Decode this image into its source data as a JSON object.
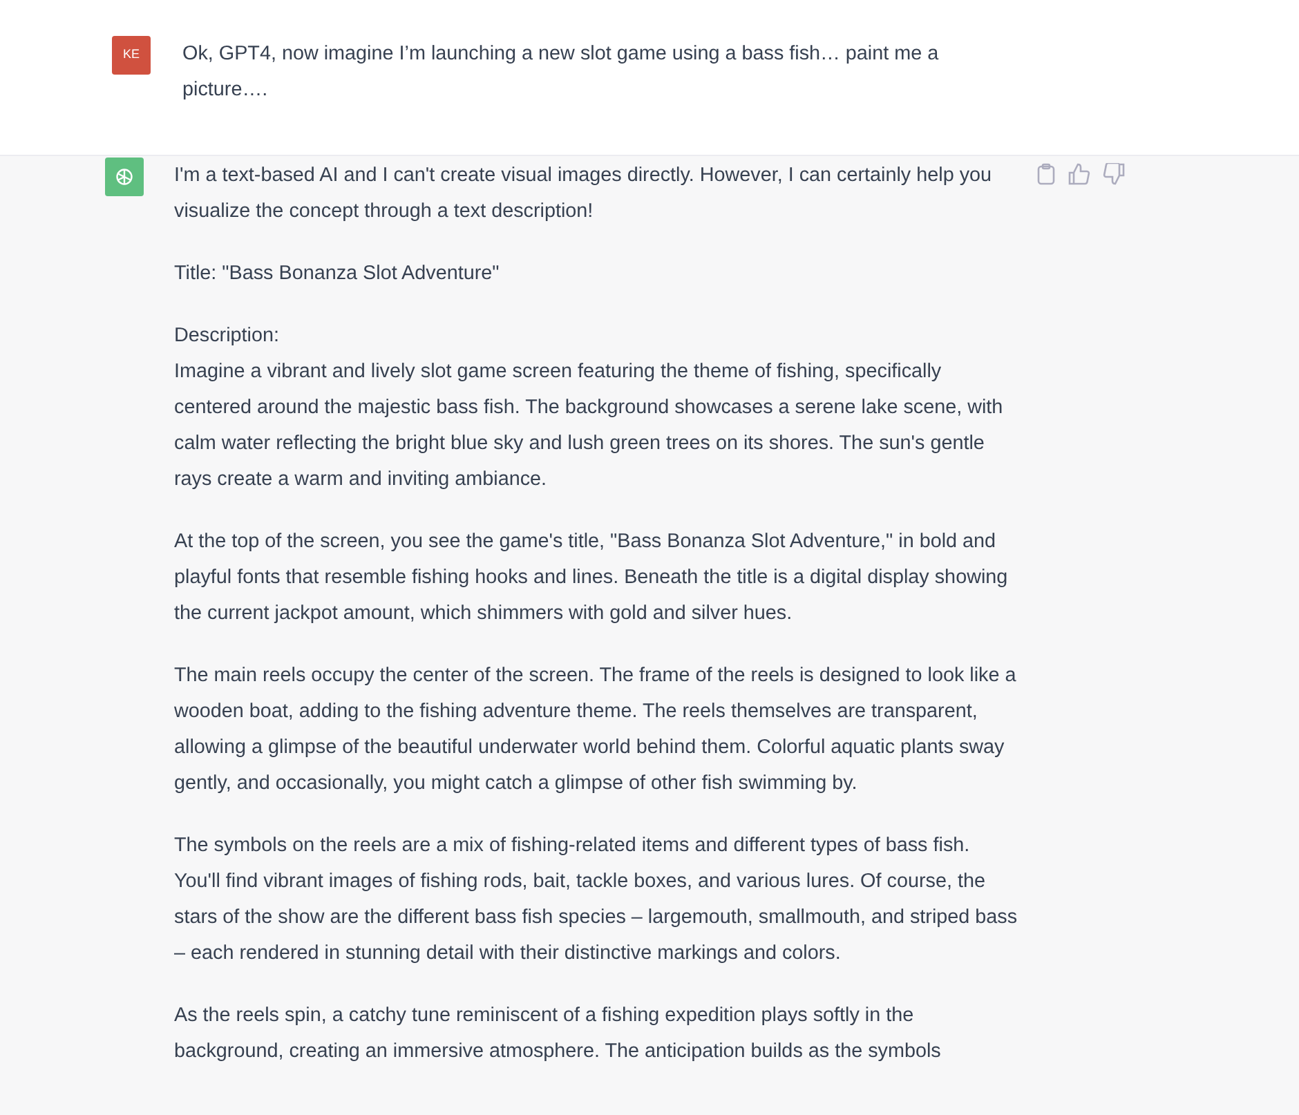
{
  "user_message": {
    "avatar": "KE",
    "text": "Ok, GPT4, now imagine I’m launching a new slot game using a bass fish… paint me a picture…."
  },
  "assistant_message": {
    "paragraphs": [
      "I'm a text-based AI and I can't create visual images directly. However, I can certainly help you visualize the concept through a text description!",
      "Title: \"Bass Bonanza Slot Adventure\"",
      "Description:\nImagine a vibrant and lively slot game screen featuring the theme of fishing, specifically centered around the majestic bass fish. The background showcases a serene lake scene, with calm water reflecting the bright blue sky and lush green trees on its shores. The sun's gentle rays create a warm and inviting ambiance.",
      "At the top of the screen, you see the game's title, \"Bass Bonanza Slot Adventure,\" in bold and playful fonts that resemble fishing hooks and lines. Beneath the title is a digital display showing the current jackpot amount, which shimmers with gold and silver hues.",
      "The main reels occupy the center of the screen. The frame of the reels is designed to look like a wooden boat, adding to the fishing adventure theme. The reels themselves are transparent, allowing a glimpse of the beautiful underwater world behind them. Colorful aquatic plants sway gently, and occasionally, you might catch a glimpse of other fish swimming by.",
      "The symbols on the reels are a mix of fishing-related items and different types of bass fish. You'll find vibrant images of fishing rods, bait, tackle boxes, and various lures. Of course, the stars of the show are the different bass fish species – largemouth, smallmouth, and striped bass – each rendered in stunning detail with their distinctive markings and colors.",
      "As the reels spin, a catchy tune reminiscent of a fishing expedition plays softly in the background, creating an immersive atmosphere. The anticipation builds as the symbols"
    ]
  }
}
